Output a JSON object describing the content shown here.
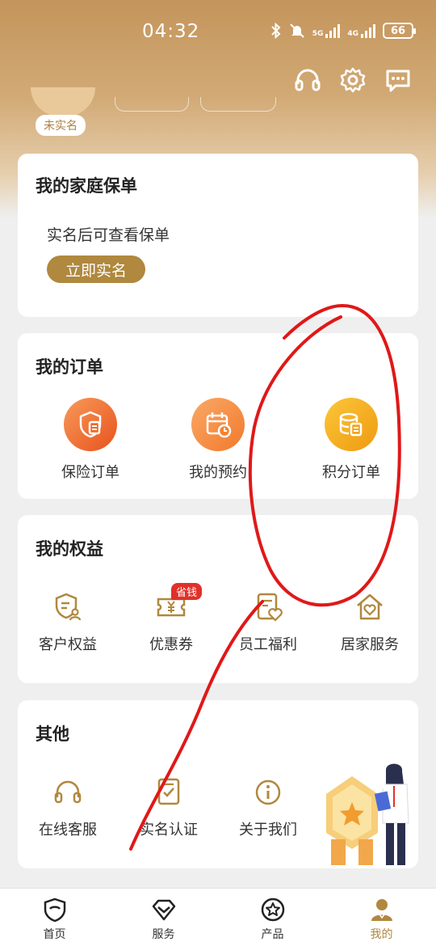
{
  "status_bar": {
    "time": "04:32",
    "signal1_label": "5G",
    "signal2_label": "4G",
    "battery": "66"
  },
  "header": {
    "unverified_badge": "未实名",
    "icons": [
      "headset-icon",
      "settings-gear-icon",
      "message-icon"
    ]
  },
  "policy_card": {
    "title": "我的家庭保单",
    "note": "实名后可查看保单",
    "button": "立即实名"
  },
  "orders_card": {
    "title": "我的订单",
    "items": [
      {
        "label": "保险订单",
        "icon": "insurance-shield-icon",
        "color": "#f06a2a"
      },
      {
        "label": "我的预约",
        "icon": "calendar-clock-icon",
        "color": "#f5832e"
      },
      {
        "label": "积分订单",
        "icon": "points-coin-icon",
        "color": "#f2a41c"
      }
    ]
  },
  "benefits_card": {
    "title": "我的权益",
    "tag": "省钱",
    "items": [
      {
        "label": "客户权益",
        "icon": "customer-shield-icon"
      },
      {
        "label": "优惠券",
        "icon": "coupon-icon"
      },
      {
        "label": "员工福利",
        "icon": "employee-welfare-icon"
      },
      {
        "label": "居家服务",
        "icon": "home-heart-icon"
      }
    ]
  },
  "other_card": {
    "title": "其他",
    "items": [
      {
        "label": "在线客服",
        "icon": "headset-icon"
      },
      {
        "label": "实名认证",
        "icon": "verify-document-icon"
      },
      {
        "label": "关于我们",
        "icon": "info-icon"
      }
    ]
  },
  "bottom_nav": {
    "items": [
      {
        "label": "首页",
        "icon": "home-shield-icon"
      },
      {
        "label": "服务",
        "icon": "diamond-icon"
      },
      {
        "label": "产品",
        "icon": "star-circle-icon"
      },
      {
        "label": "我的",
        "icon": "person-icon"
      }
    ],
    "active_index": 3
  },
  "colors": {
    "brand_gold": "#b0883e",
    "header_gold": "#c4955c",
    "annotation_red": "#e01818",
    "tag_red": "#e0312a"
  }
}
